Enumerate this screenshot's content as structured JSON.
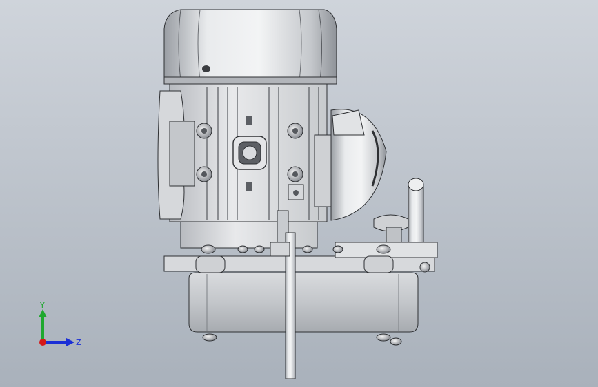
{
  "viewport": {
    "background_top": "#cfd4db",
    "background_bottom": "#a9b1bb"
  },
  "model": {
    "metal_light": "#e6e8ea",
    "metal_mid": "#c4c7cb",
    "metal_dark": "#8e9298",
    "edge": "#2e3033"
  },
  "triad": {
    "y_label": "Y",
    "z_label": "Z",
    "y_color": "#1fa82e",
    "z_color": "#1b2fd6",
    "x_color": "#d41818"
  }
}
